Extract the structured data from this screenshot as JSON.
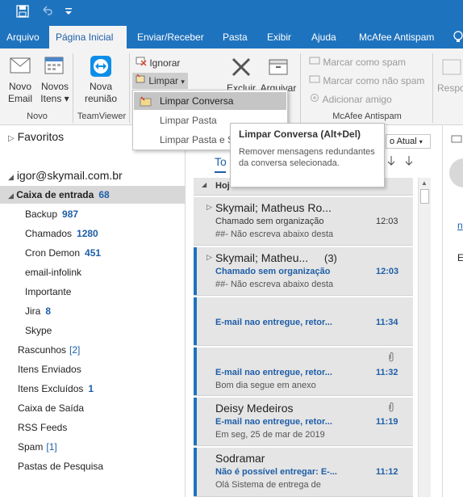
{
  "colors": {
    "accent": "#1e73be",
    "link": "#1e5ea8",
    "selected_bg": "#d8d8d8",
    "message_bg": "#e5e5e5"
  },
  "quick_access": {
    "save_icon": "save-icon",
    "undo_icon": "undo-icon",
    "customize_icon": "customize-icon"
  },
  "tabs": [
    "Arquivo",
    "Página Inicial",
    "Enviar/Receber",
    "Pasta",
    "Exibir",
    "Ajuda",
    "McAfee Antispam"
  ],
  "active_tab": "Página Inicial",
  "ribbon": {
    "novo_email_line1": "Novo",
    "novo_email_line2": "Email",
    "novos_itens_line1": "Novos",
    "novos_itens_line2": "Itens",
    "group_novo": "Novo",
    "nova_reuniao_line1": "Nova",
    "nova_reuniao_line2": "reunião",
    "group_teamviewer": "TeamViewer",
    "ignorar": "Ignorar",
    "limpar": "Limpar",
    "excluir": "Excluir",
    "arquivar": "Arquivar",
    "marcar_spam": "Marcar como spam",
    "marcar_nao_spam": "Marcar como não spam",
    "adicionar_amigo": "Adicionar amigo",
    "group_mcafee": "McAfee Antispam",
    "responder_partial": "Respo"
  },
  "limpar_menu": {
    "items": [
      "Limpar Conversa",
      "Limpar Pasta",
      "Limpar Pasta e S"
    ],
    "highlighted": "Limpar Conversa"
  },
  "tooltip": {
    "title": "Limpar Conversa (Alt+Del)",
    "body": "Remover mensagens redundantes da conversa selecionada."
  },
  "nav": {
    "favoritos": "Favoritos",
    "account": "igor@skymail.com.br",
    "folders": [
      {
        "name": "Caixa de entrada",
        "count": "68"
      },
      {
        "name": "Backup",
        "count": "987"
      },
      {
        "name": "Chamados",
        "count": "1280"
      },
      {
        "name": "Cron Demon",
        "count": "451"
      },
      {
        "name": "email-infolink",
        "count": ""
      },
      {
        "name": "Importante",
        "count": ""
      },
      {
        "name": "Jira",
        "count": "8"
      },
      {
        "name": "Skype",
        "count": ""
      },
      {
        "name": "Rascunhos",
        "count": "[2]"
      },
      {
        "name": "Itens Enviados",
        "count": ""
      },
      {
        "name": "Itens Excluídos",
        "count": "1"
      },
      {
        "name": "Caixa de Saída",
        "count": ""
      },
      {
        "name": "RSS Feeds",
        "count": ""
      },
      {
        "name": "Spam",
        "count": "[1]"
      },
      {
        "name": "Pastas de Pesquisa",
        "count": ""
      }
    ]
  },
  "list": {
    "tab_partial": "To",
    "sort_partial": "o Atual",
    "group_header_partial": "Hoj",
    "messages": [
      {
        "from": "Skymail;  Matheus Ro...",
        "subject": "Chamado sem organização",
        "preview": "##- Não escreva abaixo desta",
        "time": "12:03",
        "count": ""
      },
      {
        "from": "Skymail;  Matheu...",
        "subject": "Chamado sem organização",
        "preview": "##- Não escreva abaixo desta",
        "time": "12:03",
        "count": "(3)"
      },
      {
        "from": "",
        "subject": "E-mail nao entregue, retor...",
        "preview": "",
        "time": "11:34",
        "count": ""
      },
      {
        "from": "",
        "subject": "E-mail nao entregue, retor...",
        "preview": "Bom dia segue em anexo",
        "time": "11:32",
        "count": ""
      },
      {
        "from": "Deisy Medeiros",
        "subject": "E-mail nao entregue, retor...",
        "preview": "Em seg, 25 de mar de 2019",
        "time": "11:19",
        "count": ""
      },
      {
        "from": "Sodramar",
        "subject": "Não é possível entregar: E-...",
        "preview": "Olá Sistema de entrega de",
        "time": "11:12",
        "count": ""
      }
    ]
  },
  "reading": {
    "partial_link": "n",
    "partial_text": "E"
  }
}
